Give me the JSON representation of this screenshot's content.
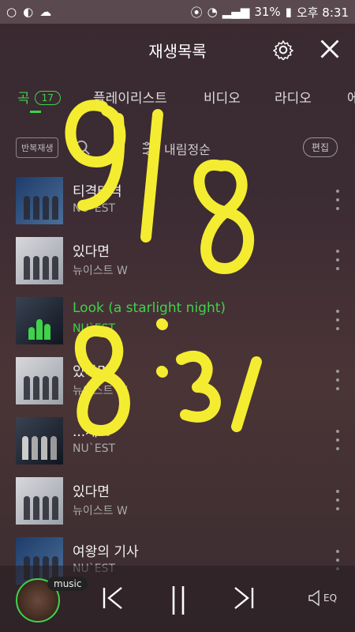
{
  "statusbar": {
    "battery": "31%",
    "time": "오후 8:31"
  },
  "header": {
    "title": "재생목록"
  },
  "tabs": [
    {
      "label": "곡",
      "count": "17"
    },
    {
      "label": "플레이리스트"
    },
    {
      "label": "비디오"
    },
    {
      "label": "라디오"
    },
    {
      "label": "에"
    }
  ],
  "toolbar": {
    "repeat_label": "반복재생",
    "sort_label": "내림정순",
    "edit_label": "편집"
  },
  "songs": [
    {
      "title": "티격태격",
      "artist": "NU`EST"
    },
    {
      "title": "있다면",
      "artist": "뉴이스트 W"
    },
    {
      "title": "Look (a starlight night)",
      "artist": "NU`EST"
    },
    {
      "title": "있다면",
      "artist": "뉴이스트 W"
    },
    {
      "title": "...세요",
      "artist": "NU`EST"
    },
    {
      "title": "있다면",
      "artist": "뉴이스트 W"
    },
    {
      "title": "여왕의 기사",
      "artist": "NU`EST"
    }
  ],
  "player": {
    "tag": "music",
    "eq_label": "EQ"
  },
  "handwriting": {
    "line1": "9/8",
    "line2": "8:31"
  },
  "colors": {
    "accent": "#3fd24a",
    "scribble": "#f4ec30"
  }
}
